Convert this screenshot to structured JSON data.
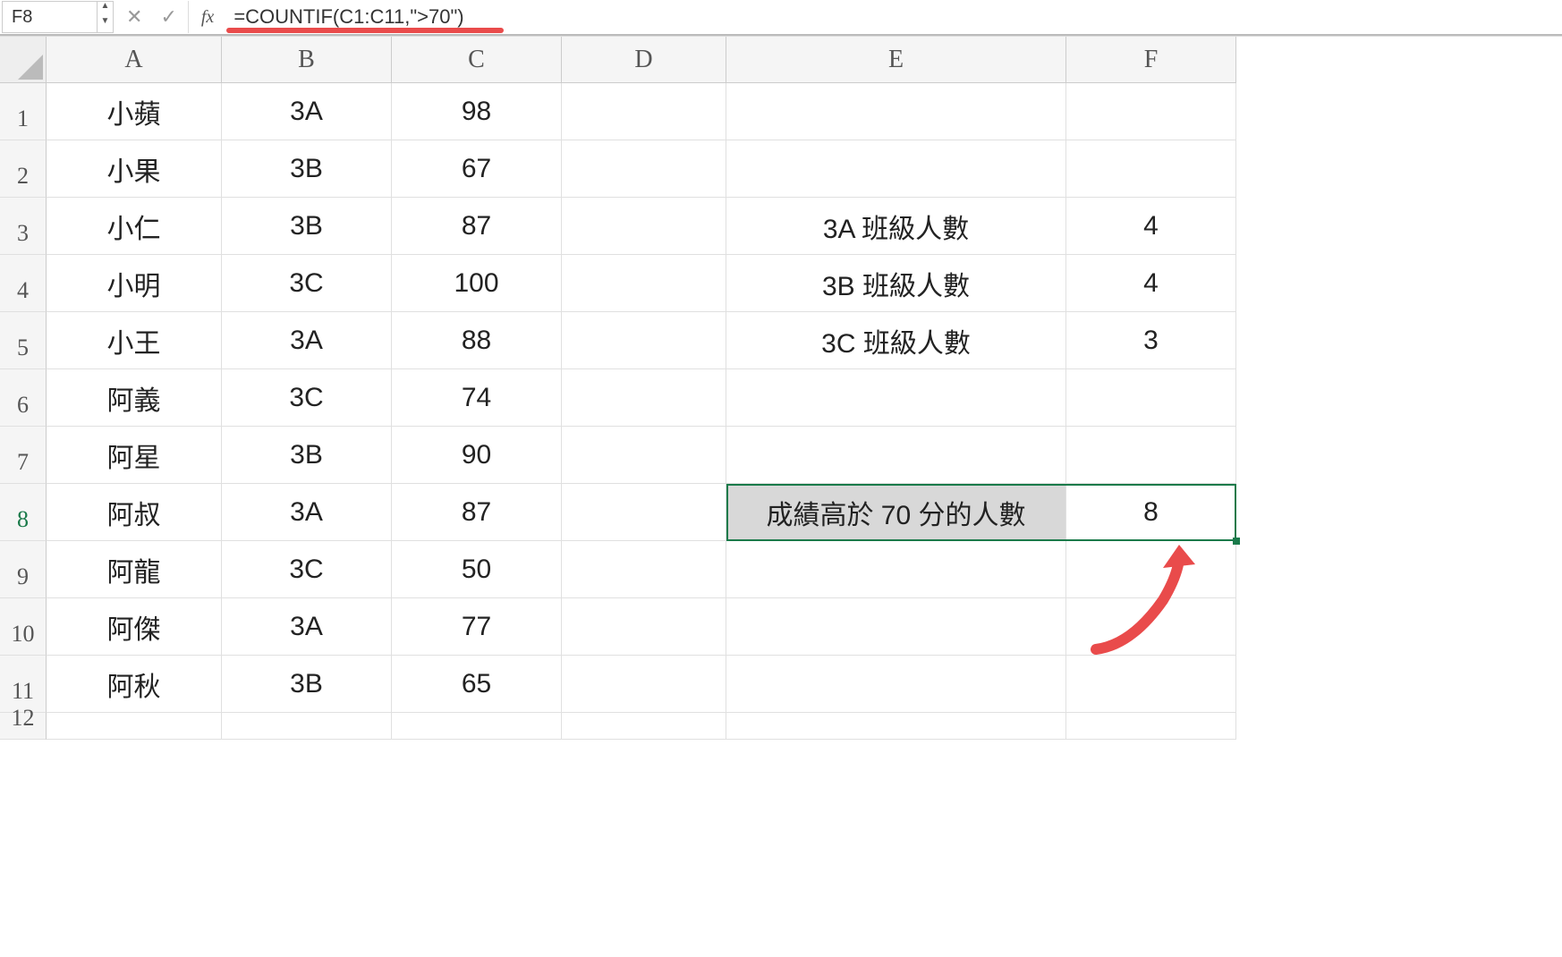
{
  "formula_bar": {
    "active_cell": "F8",
    "fx_label": "fx",
    "formula": "=COUNTIF(C1:C11,\">70\")"
  },
  "columns": [
    "A",
    "B",
    "C",
    "D",
    "E",
    "F"
  ],
  "row_numbers": [
    "1",
    "2",
    "3",
    "4",
    "5",
    "6",
    "7",
    "8",
    "9",
    "10",
    "11",
    "12"
  ],
  "active_row": 8,
  "selected_cell": "F8",
  "selected_range": "E8:F8",
  "data_rows": [
    {
      "a": "小蘋",
      "b": "3A",
      "c": "98",
      "d": "",
      "e": "",
      "f": ""
    },
    {
      "a": "小果",
      "b": "3B",
      "c": "67",
      "d": "",
      "e": "",
      "f": ""
    },
    {
      "a": "小仁",
      "b": "3B",
      "c": "87",
      "d": "",
      "e": "3A 班級人數",
      "f": "4"
    },
    {
      "a": "小明",
      "b": "3C",
      "c": "100",
      "d": "",
      "e": "3B 班級人數",
      "f": "4"
    },
    {
      "a": "小王",
      "b": "3A",
      "c": "88",
      "d": "",
      "e": "3C 班級人數",
      "f": "3"
    },
    {
      "a": "阿義",
      "b": "3C",
      "c": "74",
      "d": "",
      "e": "",
      "f": ""
    },
    {
      "a": "阿星",
      "b": "3B",
      "c": "90",
      "d": "",
      "e": "",
      "f": ""
    },
    {
      "a": "阿叔",
      "b": "3A",
      "c": "87",
      "d": "",
      "e": "成績高於 70 分的人數",
      "f": "8"
    },
    {
      "a": "阿龍",
      "b": "3C",
      "c": "50",
      "d": "",
      "e": "",
      "f": ""
    },
    {
      "a": "阿傑",
      "b": "3A",
      "c": "77",
      "d": "",
      "e": "",
      "f": ""
    },
    {
      "a": "阿秋",
      "b": "3B",
      "c": "65",
      "d": "",
      "e": "",
      "f": ""
    },
    {
      "a": "",
      "b": "",
      "c": "",
      "d": "",
      "e": "",
      "f": ""
    }
  ],
  "annotations": {
    "formula_underline_color": "#e94b4b",
    "arrow_color": "#e94b4b"
  }
}
